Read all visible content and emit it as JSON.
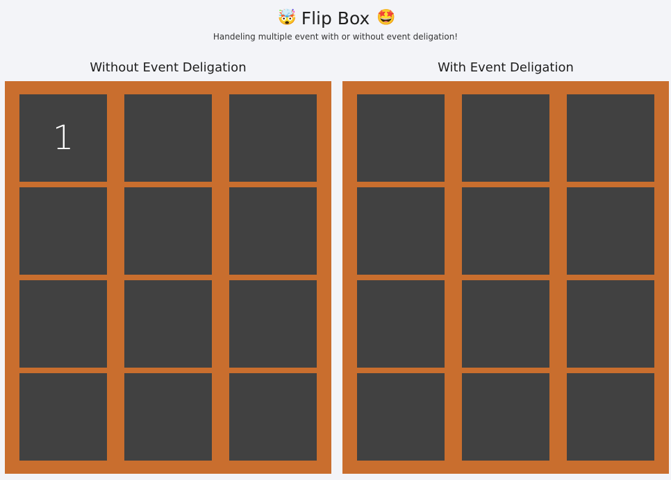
{
  "header": {
    "title": "Flip Box",
    "emoji_left": "🤯",
    "emoji_right": "🤩",
    "subtitle": "Handeling multiple event with or without event deligation!"
  },
  "sections": {
    "left": {
      "title": "Without Event Deligation",
      "cells": [
        "1",
        "",
        "",
        "",
        "",
        "",
        "",
        "",
        "",
        "",
        "",
        ""
      ]
    },
    "right": {
      "title": "With Event Deligation",
      "cells": [
        "",
        "",
        "",
        "",
        "",
        "",
        "",
        "",
        "",
        "",
        "",
        ""
      ]
    }
  },
  "colors": {
    "background": "#f3f4f8",
    "board": "#c96e2e",
    "cell": "#414141",
    "cell_text": "#ffffff"
  },
  "icons": {
    "emoji_left": "mind-blown-icon",
    "emoji_right": "star-struck-icon"
  }
}
